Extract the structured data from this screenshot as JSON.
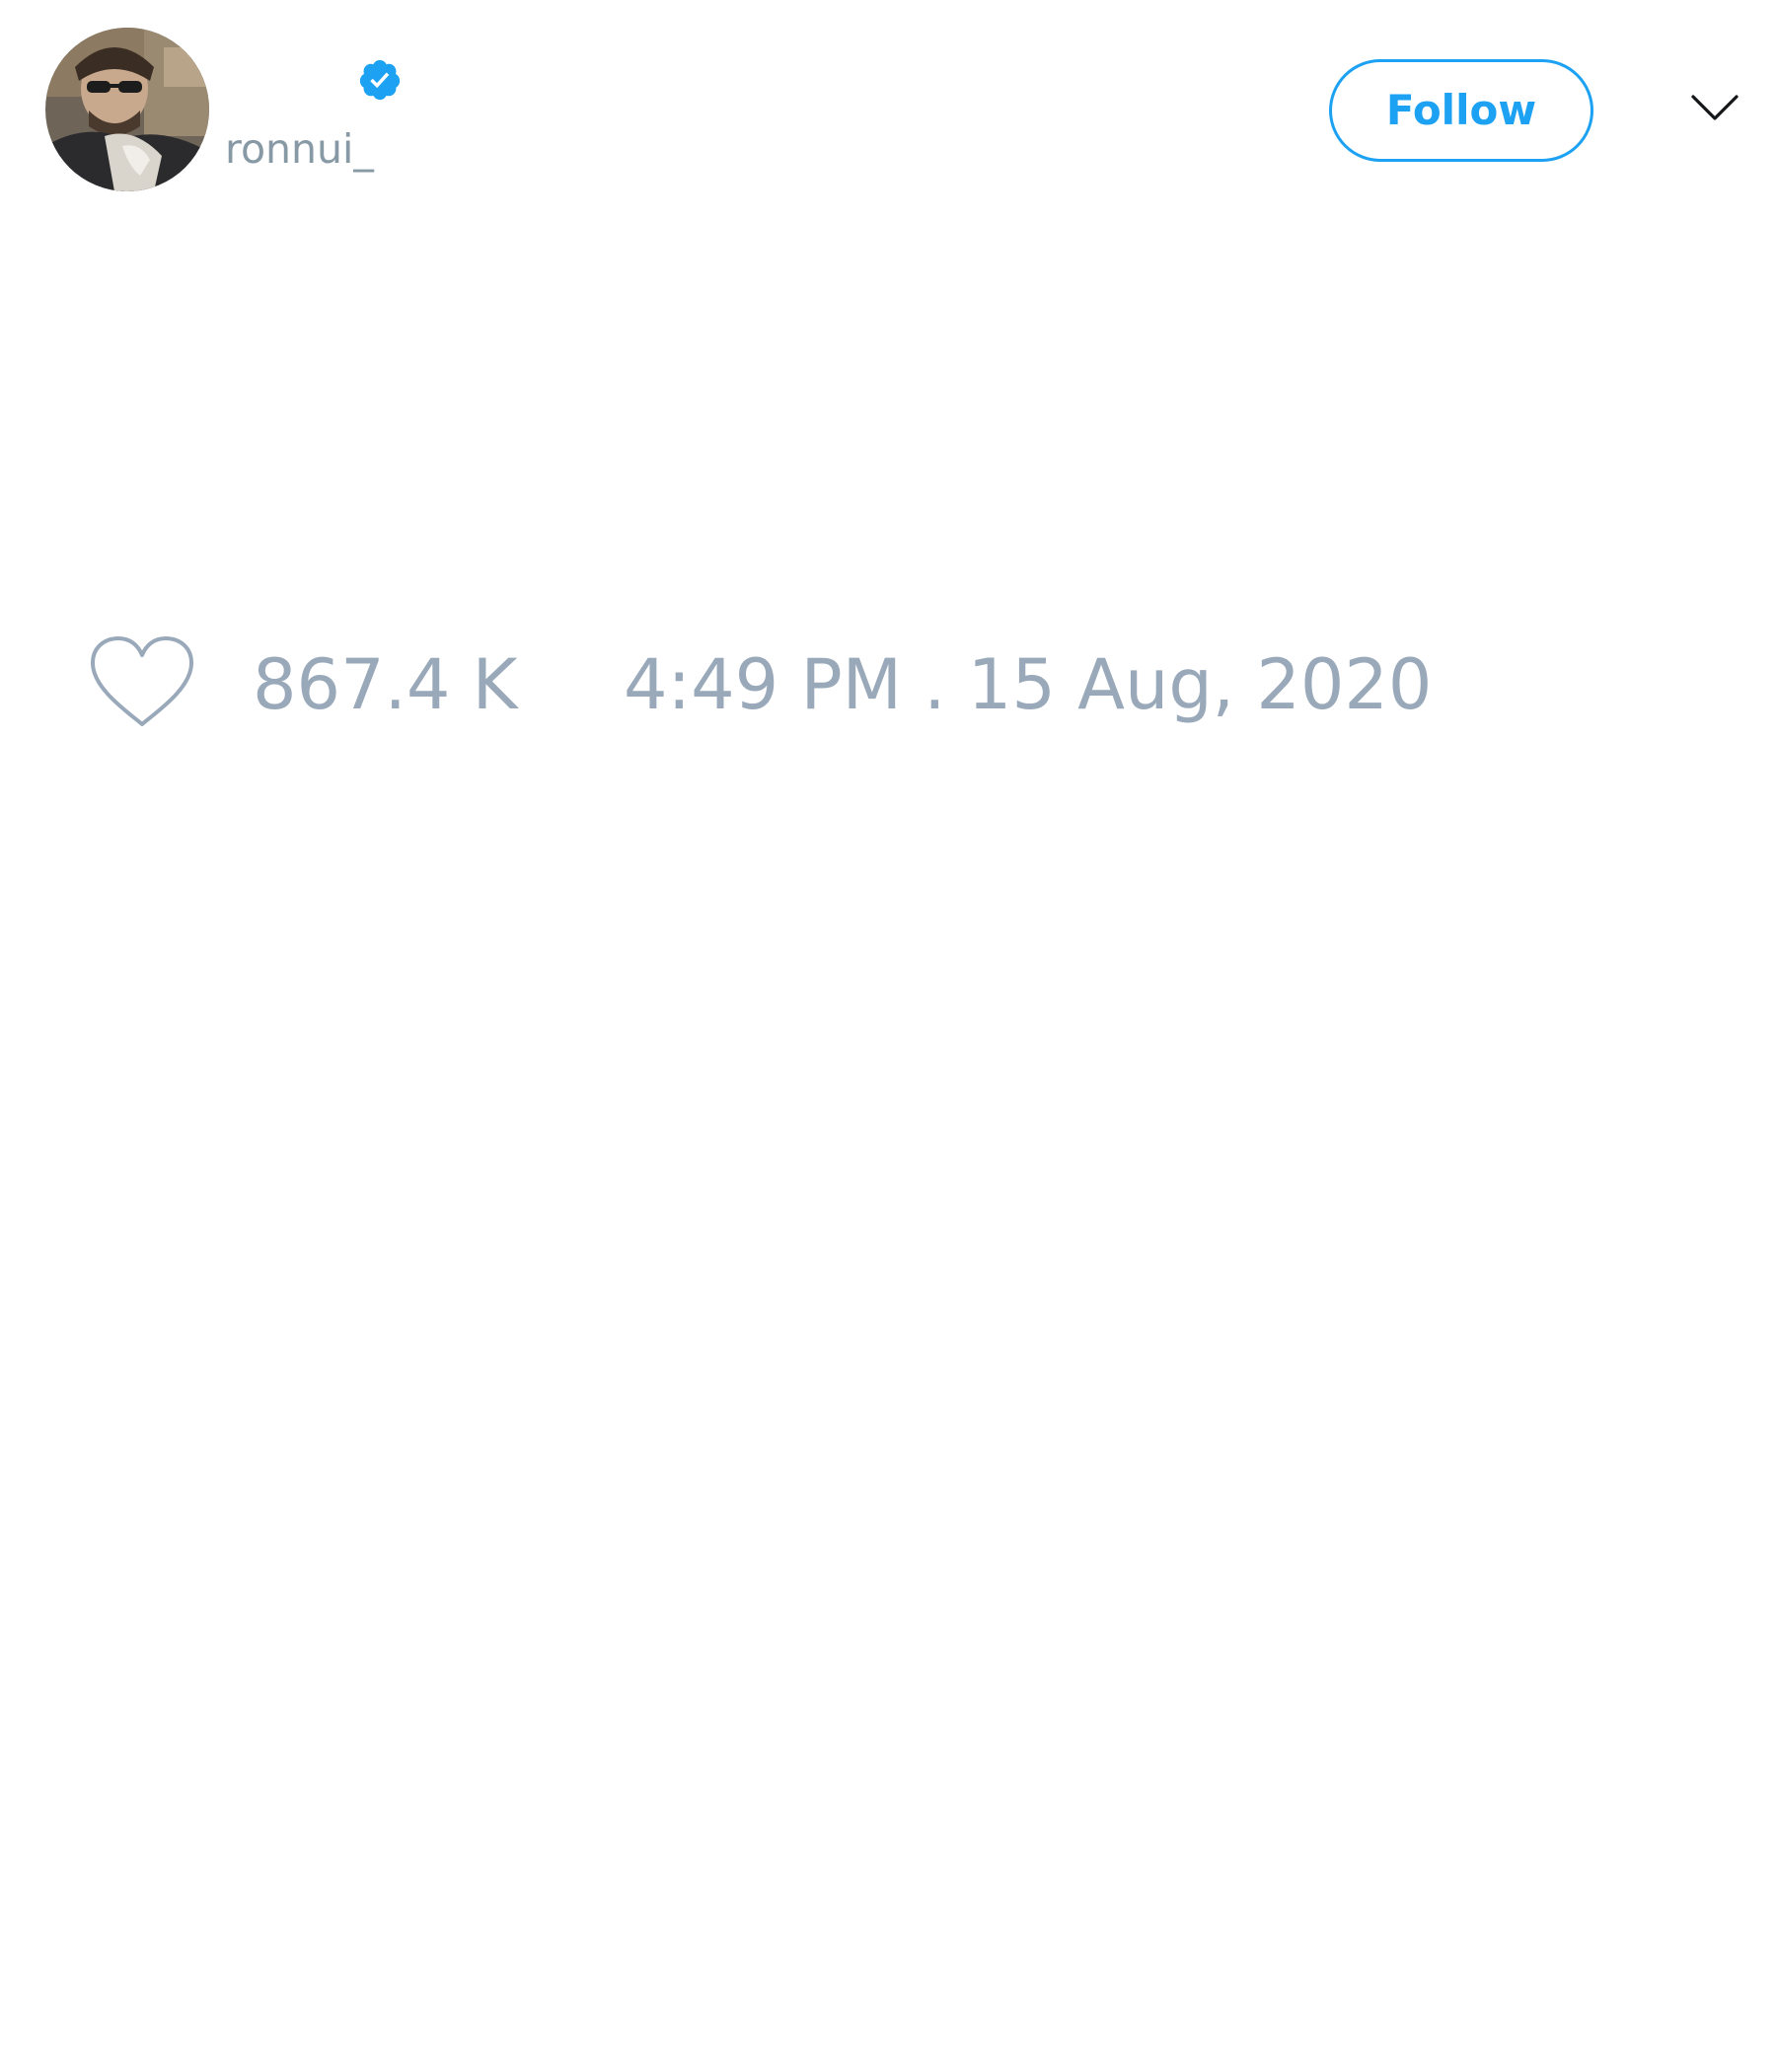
{
  "tweet": {
    "author": {
      "handle": "ronnui_",
      "verified": true,
      "avatar_icon": "user-avatar-photo"
    },
    "follow_label": "Follow",
    "more_icon": "chevron-down-icon",
    "likes": {
      "icon": "heart-outline-icon",
      "count": "867.4 K"
    },
    "timestamp": "4:49 PM . 15 Aug, 2020"
  },
  "colors": {
    "accent": "#1da1f2",
    "muted_text": "#8899a6",
    "meta_text": "#99a9ba",
    "background": "#ffffff"
  }
}
